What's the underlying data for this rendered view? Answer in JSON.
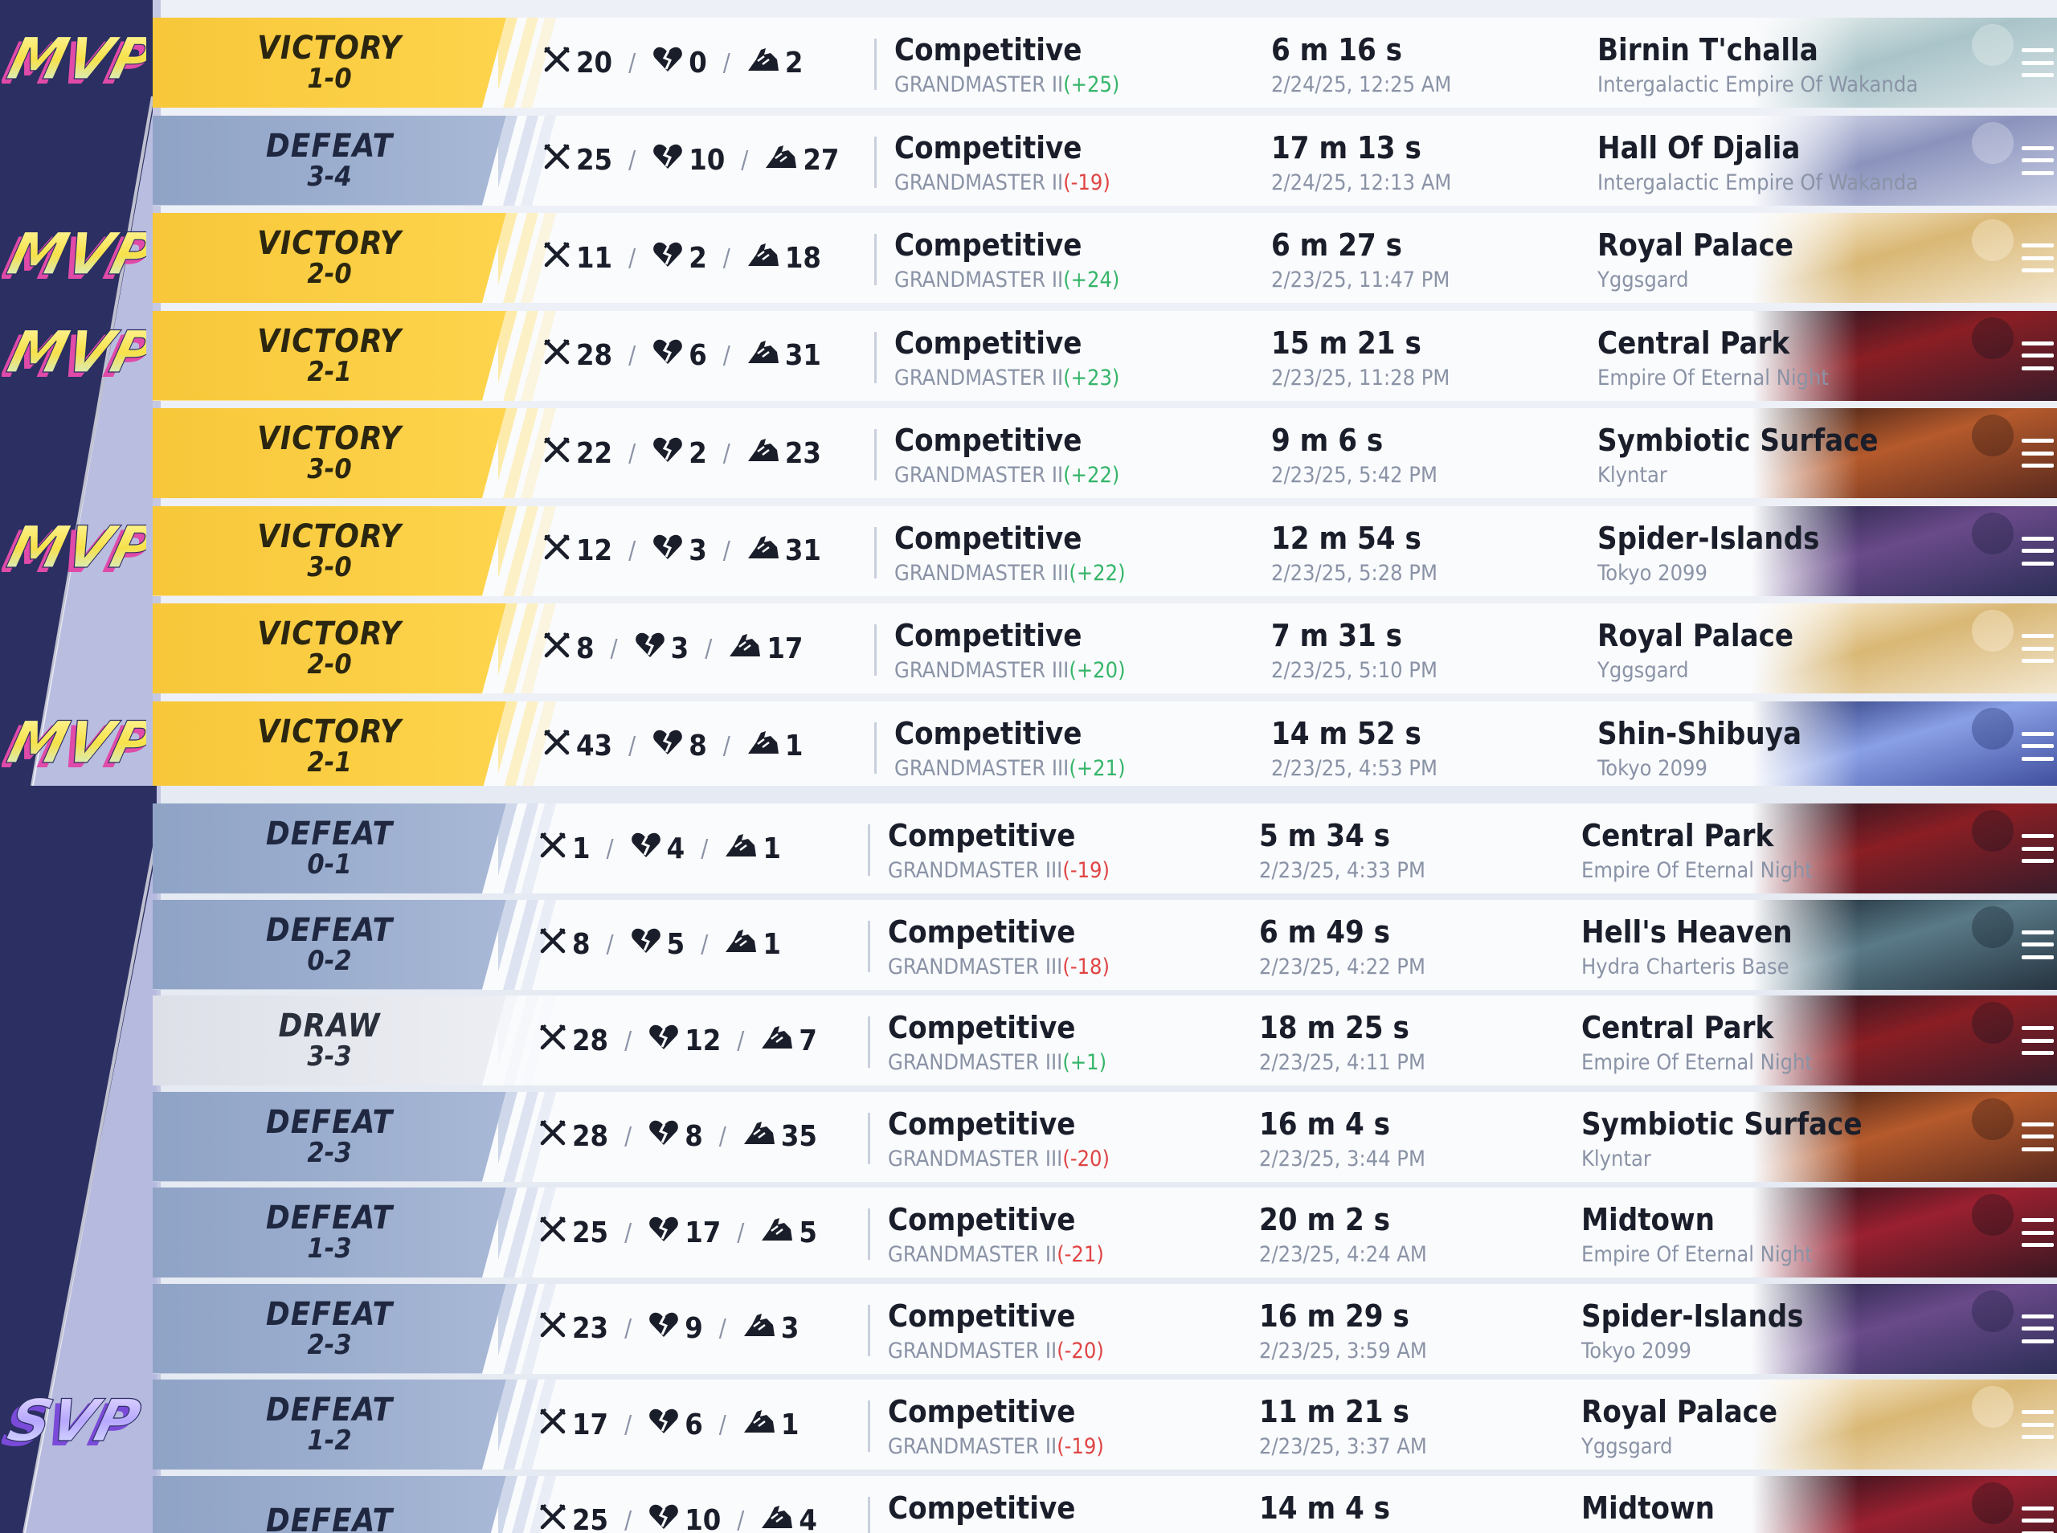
{
  "panel_a": {
    "matches": [
      {
        "badge": "MVP",
        "result": "VICTORY",
        "score": "1-0",
        "kills": "20",
        "deaths": "0",
        "assists": "2",
        "mode": "Competitive",
        "rank": "GRANDMASTER II",
        "rank_delta": "(+25)",
        "delta_sign": "plus",
        "duration": "6 m 16 s",
        "date": "2/24/25, 12:25 AM",
        "map": "Birnin T'challa",
        "region": "Intergalactic Empire Of Wakanda",
        "thumb_theme": "wakanda"
      },
      {
        "badge": "",
        "result": "DEFEAT",
        "score": "3-4",
        "kills": "25",
        "deaths": "10",
        "assists": "27",
        "mode": "Competitive",
        "rank": "GRANDMASTER II",
        "rank_delta": "(-19)",
        "delta_sign": "minus",
        "duration": "17 m 13 s",
        "date": "2/24/25, 12:13 AM",
        "map": "Hall Of Djalia",
        "region": "Intergalactic Empire Of Wakanda",
        "thumb_theme": "djalia"
      },
      {
        "badge": "MVP",
        "result": "VICTORY",
        "score": "2-0",
        "kills": "11",
        "deaths": "2",
        "assists": "18",
        "mode": "Competitive",
        "rank": "GRANDMASTER II",
        "rank_delta": "(+24)",
        "delta_sign": "plus",
        "duration": "6 m 27 s",
        "date": "2/23/25, 11:47 PM",
        "map": "Royal Palace",
        "region": "Yggsgard",
        "thumb_theme": "palace"
      },
      {
        "badge": "MVP",
        "result": "VICTORY",
        "score": "2-1",
        "kills": "28",
        "deaths": "6",
        "assists": "31",
        "mode": "Competitive",
        "rank": "GRANDMASTER II",
        "rank_delta": "(+23)",
        "delta_sign": "plus",
        "duration": "15 m 21 s",
        "date": "2/23/25, 11:28 PM",
        "map": "Central Park",
        "region": "Empire Of Eternal Night",
        "thumb_theme": "night"
      },
      {
        "badge": "",
        "result": "VICTORY",
        "score": "3-0",
        "kills": "22",
        "deaths": "2",
        "assists": "23",
        "mode": "Competitive",
        "rank": "GRANDMASTER II",
        "rank_delta": "(+22)",
        "delta_sign": "plus",
        "duration": "9 m 6 s",
        "date": "2/23/25, 5:42 PM",
        "map": "Symbiotic Surface",
        "region": "Klyntar",
        "thumb_theme": "klyntar"
      },
      {
        "badge": "MVP",
        "result": "VICTORY",
        "score": "3-0",
        "kills": "12",
        "deaths": "3",
        "assists": "31",
        "mode": "Competitive",
        "rank": "GRANDMASTER III",
        "rank_delta": "(+22)",
        "delta_sign": "plus",
        "duration": "12 m 54 s",
        "date": "2/23/25, 5:28 PM",
        "map": "Spider-Islands",
        "region": "Tokyo 2099",
        "thumb_theme": "tokyo"
      },
      {
        "badge": "",
        "result": "VICTORY",
        "score": "2-0",
        "kills": "8",
        "deaths": "3",
        "assists": "17",
        "mode": "Competitive",
        "rank": "GRANDMASTER III",
        "rank_delta": "(+20)",
        "delta_sign": "plus",
        "duration": "7 m 31 s",
        "date": "2/23/25, 5:10 PM",
        "map": "Royal Palace",
        "region": "Yggsgard",
        "thumb_theme": "palace"
      },
      {
        "badge": "MVP",
        "result": "VICTORY",
        "score": "2-1",
        "kills": "43",
        "deaths": "8",
        "assists": "1",
        "mode": "Competitive",
        "rank": "GRANDMASTER III",
        "rank_delta": "(+21)",
        "delta_sign": "plus",
        "duration": "14 m 52 s",
        "date": "2/23/25, 4:53 PM",
        "map": "Shin-Shibuya",
        "region": "Tokyo 2099",
        "thumb_theme": "shibuya"
      }
    ]
  },
  "panel_b": {
    "matches": [
      {
        "badge": "",
        "result": "DEFEAT",
        "score": "0-1",
        "kills": "1",
        "deaths": "4",
        "assists": "1",
        "mode": "Competitive",
        "rank": "GRANDMASTER III",
        "rank_delta": "(-19)",
        "delta_sign": "minus",
        "duration": "5 m 34 s",
        "date": "2/23/25, 4:33 PM",
        "map": "Central Park",
        "region": "Empire Of Eternal Night",
        "thumb_theme": "night"
      },
      {
        "badge": "",
        "result": "DEFEAT",
        "score": "0-2",
        "kills": "8",
        "deaths": "5",
        "assists": "1",
        "mode": "Competitive",
        "rank": "GRANDMASTER III",
        "rank_delta": "(-18)",
        "delta_sign": "minus",
        "duration": "6 m 49 s",
        "date": "2/23/25, 4:22 PM",
        "map": "Hell's Heaven",
        "region": "Hydra Charteris Base",
        "thumb_theme": "hydra"
      },
      {
        "badge": "",
        "result": "DRAW",
        "score": "3-3",
        "kills": "28",
        "deaths": "12",
        "assists": "7",
        "mode": "Competitive",
        "rank": "GRANDMASTER III",
        "rank_delta": "(+1)",
        "delta_sign": "plus",
        "duration": "18 m 25 s",
        "date": "2/23/25, 4:11 PM",
        "map": "Central Park",
        "region": "Empire Of Eternal Night",
        "thumb_theme": "night"
      },
      {
        "badge": "",
        "result": "DEFEAT",
        "score": "2-3",
        "kills": "28",
        "deaths": "8",
        "assists": "35",
        "mode": "Competitive",
        "rank": "GRANDMASTER III",
        "rank_delta": "(-20)",
        "delta_sign": "minus",
        "duration": "16 m 4 s",
        "date": "2/23/25, 3:44 PM",
        "map": "Symbiotic Surface",
        "region": "Klyntar",
        "thumb_theme": "klyntar"
      },
      {
        "badge": "",
        "result": "DEFEAT",
        "score": "1-3",
        "kills": "25",
        "deaths": "17",
        "assists": "5",
        "mode": "Competitive",
        "rank": "GRANDMASTER II",
        "rank_delta": "(-21)",
        "delta_sign": "minus",
        "duration": "20 m 2 s",
        "date": "2/23/25, 4:24 AM",
        "map": "Midtown",
        "region": "Empire Of Eternal Night",
        "thumb_theme": "midtown"
      },
      {
        "badge": "",
        "result": "DEFEAT",
        "score": "2-3",
        "kills": "23",
        "deaths": "9",
        "assists": "3",
        "mode": "Competitive",
        "rank": "GRANDMASTER II",
        "rank_delta": "(-20)",
        "delta_sign": "minus",
        "duration": "16 m 29 s",
        "date": "2/23/25, 3:59 AM",
        "map": "Spider-Islands",
        "region": "Tokyo 2099",
        "thumb_theme": "tokyo"
      },
      {
        "badge": "SVP",
        "result": "DEFEAT",
        "score": "1-2",
        "kills": "17",
        "deaths": "6",
        "assists": "1",
        "mode": "Competitive",
        "rank": "GRANDMASTER II",
        "rank_delta": "(-19)",
        "delta_sign": "minus",
        "duration": "11 m 21 s",
        "date": "2/23/25, 3:37 AM",
        "map": "Royal Palace",
        "region": "Yggsgard",
        "thumb_theme": "palace"
      },
      {
        "badge": "",
        "result": "DEFEAT",
        "score": "",
        "kills": "25",
        "deaths": "10",
        "assists": "4",
        "mode": "Competitive",
        "rank": "",
        "rank_delta": "",
        "delta_sign": "minus",
        "duration": "14 m 4 s",
        "date": "",
        "map": "Midtown",
        "region": "",
        "thumb_theme": "midtown"
      }
    ]
  },
  "icons": {
    "kills": "crossed-swords-icon",
    "deaths": "broken-heart-icon",
    "assists": "helping-hand-icon",
    "menu": "menu-icon"
  },
  "colors": {
    "victory": "#fdd44c",
    "defeat": "#a8b8d6",
    "draw": "#eceef3",
    "positive": "#35b569",
    "negative": "#e04444",
    "sidebar_dark": "#2a2d5e"
  }
}
